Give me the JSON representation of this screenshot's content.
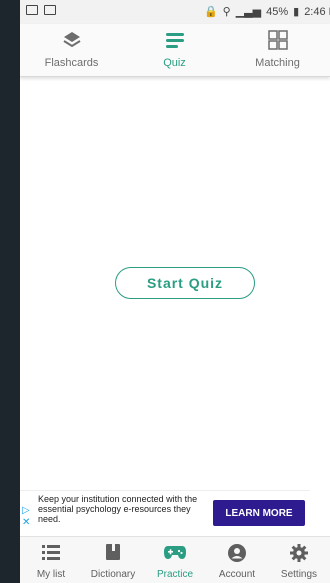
{
  "status_bar": {
    "battery": "45%",
    "time": "2:46 P"
  },
  "tabs": [
    {
      "label": "Flashcards",
      "icon": "layers-icon"
    },
    {
      "label": "Quiz",
      "icon": "quiz-lines-icon",
      "active": true
    },
    {
      "label": "Matching",
      "icon": "grid-icon"
    }
  ],
  "main": {
    "start_button": "Start Quiz"
  },
  "ad": {
    "text": "Keep your institution connected with the essential psychology e-resources they need.",
    "cta": "LEARN MORE"
  },
  "bottom_nav": [
    {
      "label": "My list",
      "icon": "list-icon"
    },
    {
      "label": "Dictionary",
      "icon": "book-icon"
    },
    {
      "label": "Practice",
      "icon": "gamepad-icon",
      "active": true
    },
    {
      "label": "Account",
      "icon": "account-icon"
    },
    {
      "label": "Settings",
      "icon": "gear-icon"
    }
  ],
  "colors": {
    "accent": "#2a9d82",
    "ad_button": "#2d1b8f",
    "background": "#1c262c"
  }
}
